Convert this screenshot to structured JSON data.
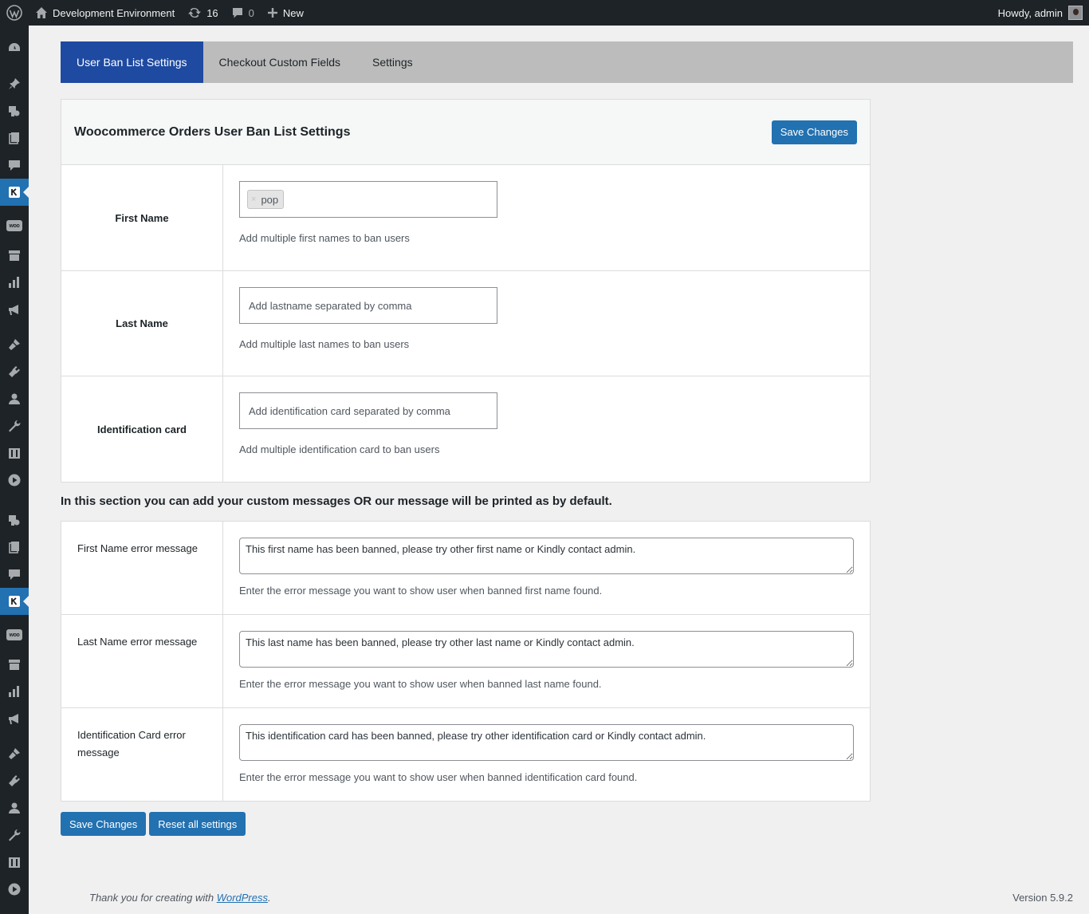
{
  "adminbar": {
    "site_name": "Development Environment",
    "updates_count": "16",
    "comments_count": "0",
    "new_label": "New",
    "howdy": "Howdy, admin"
  },
  "sidebar": {
    "active_color": "#2271b1",
    "icons": [
      "dashboard-icon",
      "pin-icon",
      "media-icon",
      "pages-icon",
      "comments-icon",
      "plugin-k-icon",
      "woo-icon",
      "archive-icon",
      "analytics-icon",
      "marketing-icon",
      "appearance-icon",
      "plugins-icon",
      "users-icon",
      "tools-icon",
      "settings-icon",
      "play-icon",
      "media-icon",
      "pages-icon",
      "comments-icon",
      "plugin-k-icon",
      "woo-icon",
      "archive-icon",
      "analytics-icon",
      "marketing-icon",
      "appearance-icon",
      "plugins-icon",
      "users-icon",
      "tools-icon",
      "settings-icon",
      "play-icon"
    ]
  },
  "tabs": [
    {
      "label": "User Ban List Settings",
      "active": true
    },
    {
      "label": "Checkout Custom Fields",
      "active": false
    },
    {
      "label": "Settings",
      "active": false
    }
  ],
  "panel1": {
    "title": "Woocommerce Orders User Ban List Settings",
    "save_label": "Save Changes",
    "first_name": {
      "label": "First Name",
      "tags": [
        "pop"
      ],
      "tag_remove": "×",
      "description": "Add multiple first names to ban users"
    },
    "last_name": {
      "label": "Last Name",
      "placeholder": "Add lastname separated by comma",
      "description": "Add multiple last names to ban users"
    },
    "id_card": {
      "label": "Identification card",
      "placeholder": "Add identification card separated by comma",
      "description": "Add multiple identification card to ban users"
    }
  },
  "section_note": "In this section you can add your custom messages OR our message will be printed as by default.",
  "panel2": {
    "first_name_msg": {
      "label": "First Name error message",
      "value": "This first name has been banned, please try other first name or Kindly contact admin.",
      "description": "Enter the error message you want to show user when banned first name found."
    },
    "last_name_msg": {
      "label": "Last Name error message",
      "value": "This last name has been banned, please try other last name or Kindly contact admin.",
      "description": "Enter the error message you want to show user when banned last name found."
    },
    "id_card_msg": {
      "label": "Identification Card error message",
      "value": "This identification card has been banned, please try other identification card or Kindly contact admin.",
      "description": "Enter the error message you want to show user when banned identification card found."
    }
  },
  "bottom": {
    "save_label": "Save Changes",
    "reset_label": "Reset all settings"
  },
  "footer": {
    "thanks_prefix": "Thank you for creating with ",
    "wordpress_link": "WordPress",
    "thanks_suffix": ".",
    "version": "Version 5.9.2"
  }
}
